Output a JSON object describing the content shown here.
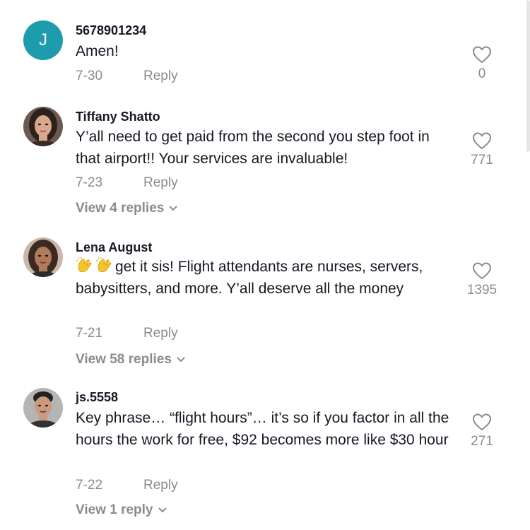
{
  "comments": [
    {
      "username": "5678901234",
      "avatar": {
        "type": "letter",
        "letter": "J",
        "color": "#1e9cae"
      },
      "text": "Amen!",
      "date": "7-30",
      "reply_label": "Reply",
      "likes": "0",
      "view_replies": null
    },
    {
      "username": "Tiffany Shatto",
      "avatar": {
        "type": "photo",
        "icon": "woman-portrait"
      },
      "text": "Y’all need to get paid from the second you step foot in that airport!! Your services are invaluable!",
      "date": "7-23",
      "reply_label": "Reply",
      "likes": "771",
      "view_replies": "View 4 replies"
    },
    {
      "username": "Lena August",
      "avatar": {
        "type": "photo",
        "icon": "woman-portrait"
      },
      "emoji": [
        "clapping-hands",
        "clapping-hands"
      ],
      "text": "get it sis! Flight attendants are nurses, servers, babysitters, and more. Y’all deserve all the money",
      "date": "7-21",
      "reply_label": "Reply",
      "likes": "1395",
      "view_replies": "View 58 replies"
    },
    {
      "username": "js.5558",
      "avatar": {
        "type": "photo",
        "icon": "man-portrait"
      },
      "text": "Key phrase… “flight hours”… it’s so if you factor in all the hours the work for free, $92 becomes more like $30 hour",
      "date": "7-22",
      "reply_label": "Reply",
      "likes": "271",
      "view_replies": "View 1 reply"
    }
  ]
}
